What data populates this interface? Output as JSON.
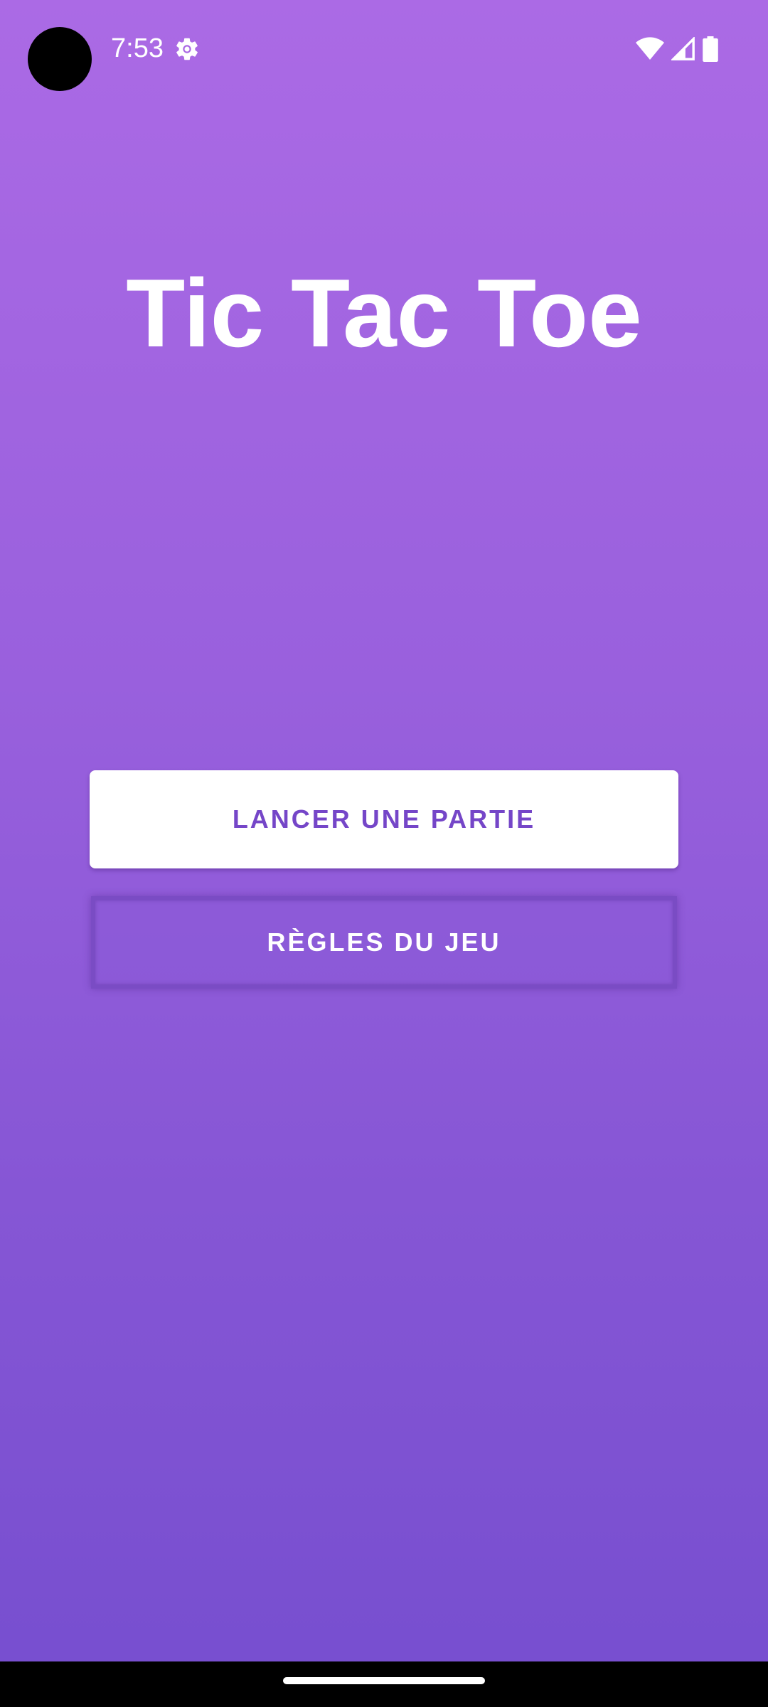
{
  "status_bar": {
    "time": "7:53",
    "icons": {
      "left": [
        "settings-gear-icon"
      ],
      "right": [
        "wifi-icon",
        "cellular-signal-icon",
        "battery-icon"
      ]
    }
  },
  "main": {
    "title": "Tic Tac Toe",
    "buttons": {
      "start_game": "LANCER UNE PARTIE",
      "rules": "RÈGLES DU JEU"
    }
  },
  "colors": {
    "background_top": "#ab6ae5",
    "background_bottom": "#764ecf",
    "accent_text": "#7546c8",
    "primary_button_bg": "#ffffff"
  }
}
